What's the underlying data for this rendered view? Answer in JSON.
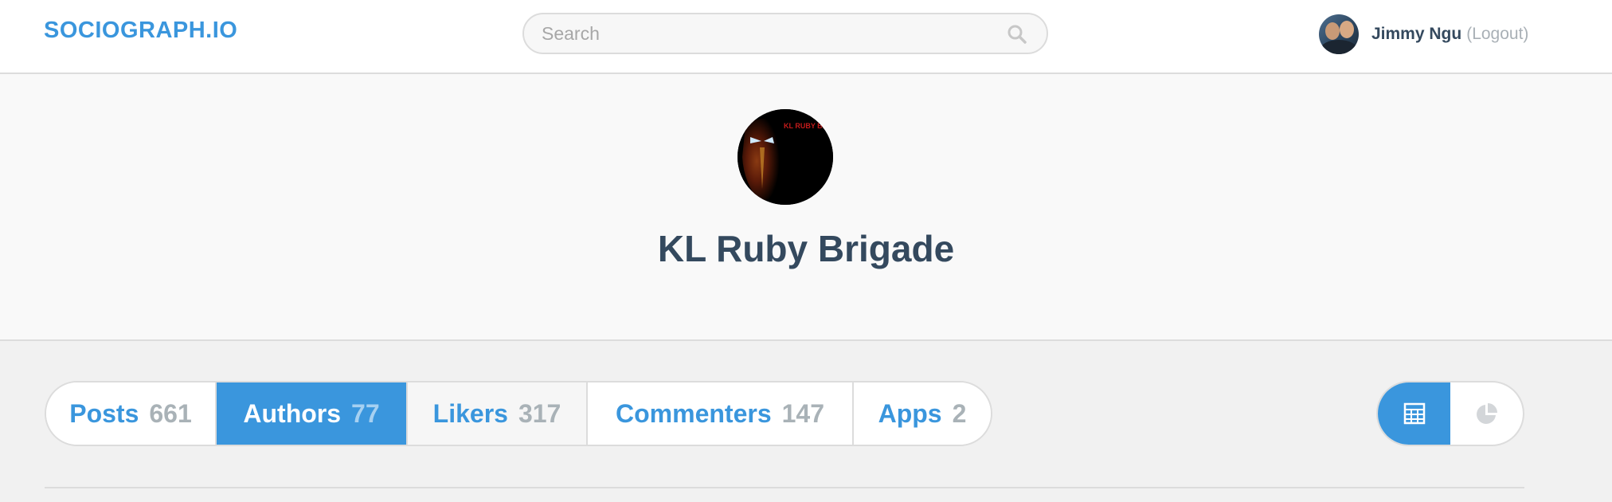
{
  "header": {
    "brand": "SOCIOGRAPH.IO",
    "search_placeholder": "Search",
    "user_name": "Jimmy Ngu",
    "logout_label": "(Logout)"
  },
  "profile": {
    "group_name": "KL Ruby Brigade",
    "avatar_text": "KL RUBY BRIGADE"
  },
  "tabs": [
    {
      "label": "Posts",
      "count": "661",
      "active": false
    },
    {
      "label": "Authors",
      "count": "77",
      "active": true
    },
    {
      "label": "Likers",
      "count": "317",
      "active": false
    },
    {
      "label": "Commenters",
      "count": "147",
      "active": false
    },
    {
      "label": "Apps",
      "count": "2",
      "active": false
    }
  ],
  "view_toggle": {
    "options": [
      {
        "icon": "table-grid-icon",
        "active": true
      },
      {
        "icon": "pie-chart-icon",
        "active": false
      }
    ]
  },
  "colors": {
    "accent": "#3a96dd",
    "title": "#34495e",
    "muted": "#a9b2b7"
  }
}
